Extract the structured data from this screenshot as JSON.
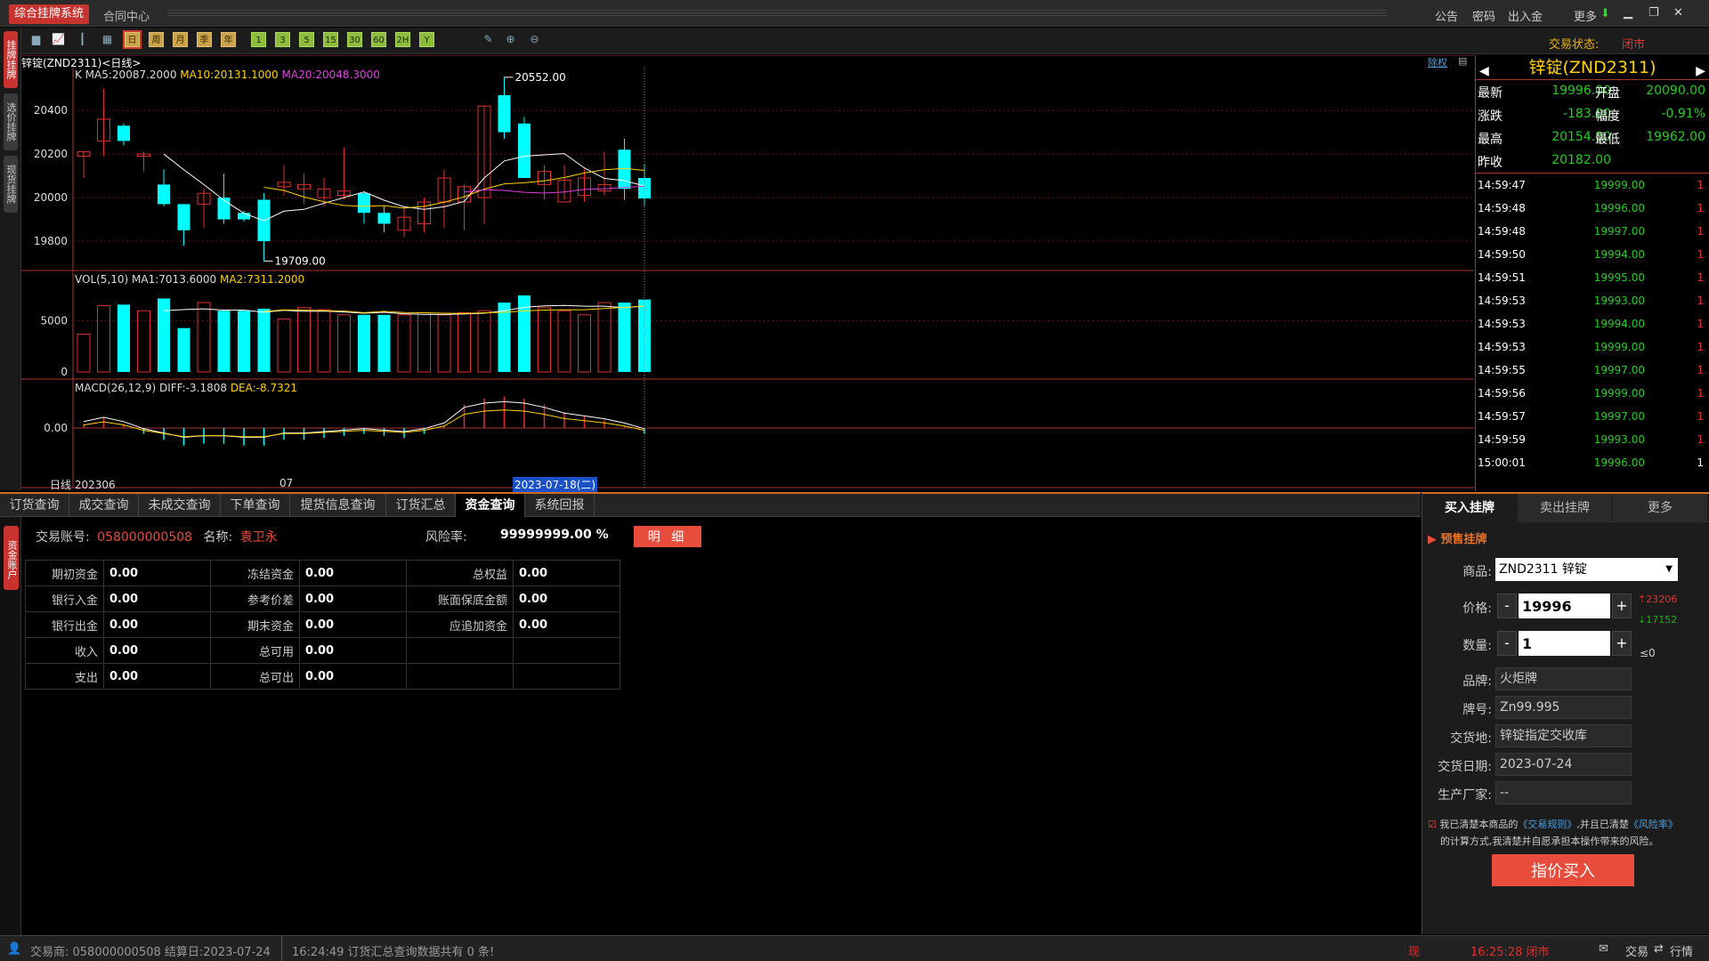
{
  "titlebar": {
    "app_title": "综合挂牌系统",
    "tab": "合同中心",
    "links": [
      "公告",
      "密码",
      "出入金",
      "更多"
    ]
  },
  "toolbar": {
    "periods": [
      "日",
      "周",
      "月",
      "季",
      "年"
    ],
    "minutes": [
      "1",
      "3",
      "5",
      "15",
      "30",
      "60",
      "2H",
      "Y"
    ],
    "trade_status_label": "交易状态:",
    "trade_status_value": "闭市"
  },
  "left_tabs": [
    "挂牌挂牌",
    "选价挂牌",
    "现货挂牌"
  ],
  "chart": {
    "header": "锌锭(ZND2311)<日线>",
    "link_right": "除权",
    "kline": {
      "title_label": "K MA5:20087.2000",
      "ma10": "MA10:20131.1000",
      "ma20": "MA20:20048.3000",
      "y_ticks": [
        "20400",
        "20200",
        "20000",
        "19800"
      ],
      "high_label": "20552.00",
      "low_label": "19709.00"
    },
    "volume": {
      "title": "VOL(5,10)",
      "ma1": "MA1:7013.6000",
      "ma2": "MA2:7311.2000",
      "y_ticks": [
        "5000",
        "0"
      ]
    },
    "macd": {
      "title": "MACD(26,12,9)",
      "diff": "DIFF:-3.1808",
      "dea": "DEA:-8.7321",
      "y_ticks": [
        "0.00"
      ]
    },
    "x_labels": [
      "日线 202306",
      "07"
    ],
    "cursor_date": "2023-07-18(二)"
  },
  "chart_data": {
    "type": "candlestick",
    "series": [
      {
        "values": [
          [
            20190,
            20210,
            20210,
            20090
          ],
          [
            20260,
            20360,
            20500,
            20190
          ],
          [
            20330,
            20260,
            20340,
            20240
          ],
          [
            20190,
            20200,
            20210,
            20120
          ],
          [
            20060,
            19970,
            20130,
            19960
          ],
          [
            19970,
            19850,
            19970,
            19780
          ],
          [
            19970,
            20020,
            20040,
            19860
          ],
          [
            20000,
            19900,
            20110,
            19880
          ],
          [
            19930,
            19900,
            19940,
            19890
          ],
          [
            19990,
            19800,
            20020,
            19709
          ],
          [
            20050,
            20070,
            20150,
            20010
          ],
          [
            20040,
            20060,
            20110,
            19970
          ],
          [
            20000,
            20040,
            20090,
            19960
          ],
          [
            20010,
            20030,
            20230,
            19990
          ],
          [
            20020,
            19930,
            20030,
            19880
          ],
          [
            19930,
            19880,
            19960,
            19840
          ],
          [
            19850,
            19910,
            19960,
            19820
          ],
          [
            19880,
            19980,
            20000,
            19840
          ],
          [
            19980,
            20090,
            20130,
            19860
          ],
          [
            19980,
            20050,
            20060,
            19850
          ],
          [
            20000,
            20420,
            20420,
            19880
          ],
          [
            20470,
            20300,
            20552,
            20270
          ],
          [
            20340,
            20090,
            20370,
            20090
          ],
          [
            20060,
            20120,
            20150,
            19990
          ],
          [
            19980,
            20080,
            20150,
            19990
          ],
          [
            20010,
            20090,
            20130,
            19980
          ],
          [
            20030,
            20060,
            20210,
            20010
          ],
          [
            20220,
            20040,
            20270,
            19990
          ],
          [
            20090,
            19996,
            20154,
            19962
          ]
        ]
      },
      {
        "name": "VOL",
        "values": [
          3700,
          6500,
          6600,
          6000,
          7200,
          4300,
          6800,
          6000,
          6000,
          6200,
          5200,
          6300,
          6100,
          5600,
          5600,
          5600,
          5600,
          5800,
          5600,
          5800,
          6000,
          6800,
          7500,
          6300,
          6000,
          5600,
          6800,
          6800,
          7100
        ]
      },
      {
        "name": "MACD",
        "values": [
          2,
          5,
          2,
          -3,
          -6,
          -9,
          -8,
          -8,
          -9,
          -9,
          -6,
          -6,
          -5,
          -4,
          -3,
          -4,
          -5,
          -3,
          1,
          12,
          15,
          16,
          15,
          12,
          8,
          6,
          4,
          1,
          -3
        ]
      }
    ],
    "ylim": [
      19709,
      20552
    ]
  },
  "quote": {
    "title": "锌锭(ZND2311)",
    "rows": [
      {
        "l1": "最新",
        "v1": "19996.00",
        "l2": "开盘",
        "v2": "20090.00"
      },
      {
        "l1": "涨跌",
        "v1": "-183.00",
        "l2": "幅度",
        "v2": "-0.91%"
      },
      {
        "l1": "最高",
        "v1": "20154.00",
        "l2": "最低",
        "v2": "19962.00"
      },
      {
        "l1": "昨收",
        "v1": "20182.00",
        "l2": "",
        "v2": ""
      }
    ],
    "ticks": [
      {
        "time": "14:59:47",
        "price": "19999.00",
        "vol": "1"
      },
      {
        "time": "14:59:48",
        "price": "19996.00",
        "vol": "1"
      },
      {
        "time": "14:59:48",
        "price": "19997.00",
        "vol": "1"
      },
      {
        "time": "14:59:50",
        "price": "19994.00",
        "vol": "1"
      },
      {
        "time": "14:59:51",
        "price": "19995.00",
        "vol": "1"
      },
      {
        "time": "14:59:53",
        "price": "19993.00",
        "vol": "1"
      },
      {
        "time": "14:59:53",
        "price": "19994.00",
        "vol": "1"
      },
      {
        "time": "14:59:53",
        "price": "19999.00",
        "vol": "1"
      },
      {
        "time": "14:59:55",
        "price": "19997.00",
        "vol": "1"
      },
      {
        "time": "14:59:56",
        "price": "19999.00",
        "vol": "1"
      },
      {
        "time": "14:59:57",
        "price": "19997.00",
        "vol": "1"
      },
      {
        "time": "14:59:59",
        "price": "19993.00",
        "vol": "1"
      },
      {
        "time": "15:00:01",
        "price": "19996.00",
        "vol": "1"
      }
    ]
  },
  "bottom": {
    "tabs": [
      "订货查询",
      "成交查询",
      "未成交查询",
      "下单查询",
      "提货信息查询",
      "订货汇总",
      "资金查询",
      "系统回报"
    ],
    "side_tab": "资金账户",
    "account_label": "交易账号:",
    "account": "058000000508",
    "name_label": "名称:",
    "name": "袁卫永",
    "risk_label": "风险率:",
    "risk": "99999999.00 %",
    "detail_btn": "明 细",
    "table": [
      [
        "期初资金",
        "0.00",
        "冻结资金",
        "0.00",
        "总权益",
        "0.00"
      ],
      [
        "银行入金",
        "0.00",
        "参考价差",
        "0.00",
        "账面保底金额",
        "0.00"
      ],
      [
        "银行出金",
        "0.00",
        "期末资金",
        "0.00",
        "应追加资金",
        "0.00"
      ],
      [
        "收入",
        "0.00",
        "总可用",
        "0.00",
        "",
        ""
      ],
      [
        "支出",
        "0.00",
        "总可出",
        "0.00",
        "",
        ""
      ]
    ]
  },
  "order": {
    "tabs": [
      "买入挂牌",
      "卖出挂牌",
      "更多"
    ],
    "sub_title": "预售挂牌",
    "product_label": "商品:",
    "product": "ZND2311 锌锭",
    "price_label": "价格:",
    "price": "19996",
    "limit_up": "23206",
    "limit_down": "17152",
    "qty_label": "数量:",
    "qty": "1",
    "qty_hint": "≤0",
    "brand_label": "品牌:",
    "brand": "火炬牌",
    "grade_label": "牌号:",
    "grade": "Zn99.995",
    "place_label": "交货地:",
    "place": "锌锭指定交收库",
    "date_label": "交货日期:",
    "date": "2023-07-24",
    "maker_label": "生产厂家:",
    "maker": "--",
    "agree_1": "我已清楚本商品的",
    "agree_link1": "《交易规则》",
    "agree_2": ",并且已清楚",
    "agree_link2": "《风险率》",
    "agree_3": "的计算方式,我清楚并自愿承担本操作带来的风险。",
    "submit": "指价买入"
  },
  "status": {
    "left": "交易商: 058000000508 结算日:2023-07-24",
    "msg": "16:24:49 订货汇总查询数据共有 0 条!",
    "mode": "现",
    "time": "16:25:28 闭市",
    "trade": "交易",
    "quote": "行情"
  },
  "colors": {
    "up": "#e03030",
    "down": "#00ffff",
    "accent": "#c8322f",
    "gold": "#ffd200",
    "green": "#22cc22"
  }
}
